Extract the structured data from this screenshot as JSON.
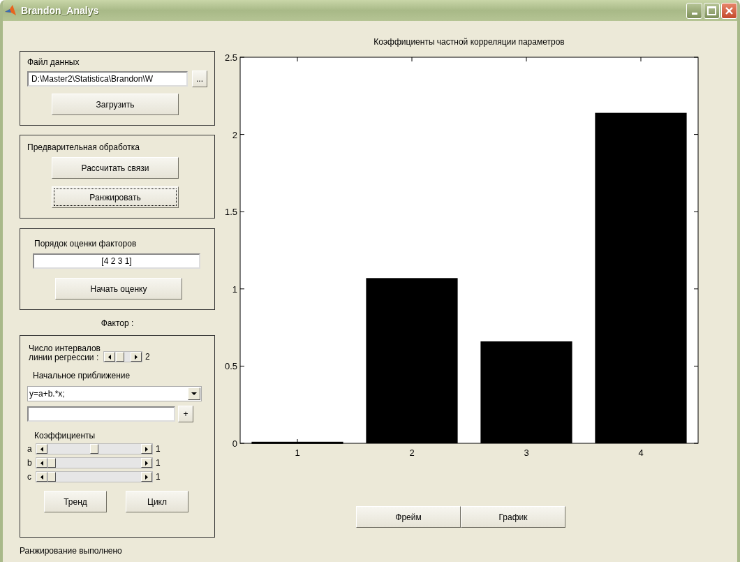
{
  "window": {
    "title": "Brandon_Analys"
  },
  "data_file": {
    "label": "Файл данных",
    "path": "D:\\Master2\\Statistica\\Brandon\\W",
    "browse_button": "...",
    "load_button": "Загрузить"
  },
  "preprocessing": {
    "label": "Предварительная обработка",
    "buttons": [
      {
        "label": "Рассчитать связи",
        "focused": false
      },
      {
        "label": "Ранжировать",
        "focused": true
      }
    ]
  },
  "order": {
    "label": "Порядок оценки факторов",
    "value": "[4 2 3 1]",
    "button": "Начать оценку"
  },
  "factor_label": "Фактор :",
  "factor": {
    "interval_label": "Число интервалов\nлинии регрессии :",
    "interval_slider": {
      "level": 0.15,
      "reading": "2"
    },
    "approx_label": "Начальное приближение",
    "approx_select": {
      "value": "y=a+b.*x;"
    },
    "add_button": "+",
    "coef_label": "Коэффициенты",
    "coefficients": [
      {
        "name": "a",
        "level": 0.5,
        "reading": "1"
      },
      {
        "name": "b",
        "level": 0,
        "reading": "1"
      },
      {
        "name": "c",
        "level": 0,
        "reading": "1"
      }
    ],
    "buttons": [
      "Тренд",
      "Цикл"
    ]
  },
  "chart": {
    "chart_data": {
      "type": "bar",
      "title": "Коэффициенты частной корреляции параметров",
      "categories": [
        "1",
        "2",
        "3",
        "4"
      ],
      "values": [
        0.01,
        1.07,
        0.66,
        2.14
      ],
      "ylim": [
        0,
        2.5
      ],
      "yticks": [
        0,
        0.5,
        1,
        1.5,
        2,
        2.5
      ]
    }
  },
  "view_buttons": [
    "Фрейм",
    "График"
  ],
  "status_bar": "Ранжирование выполнено"
}
